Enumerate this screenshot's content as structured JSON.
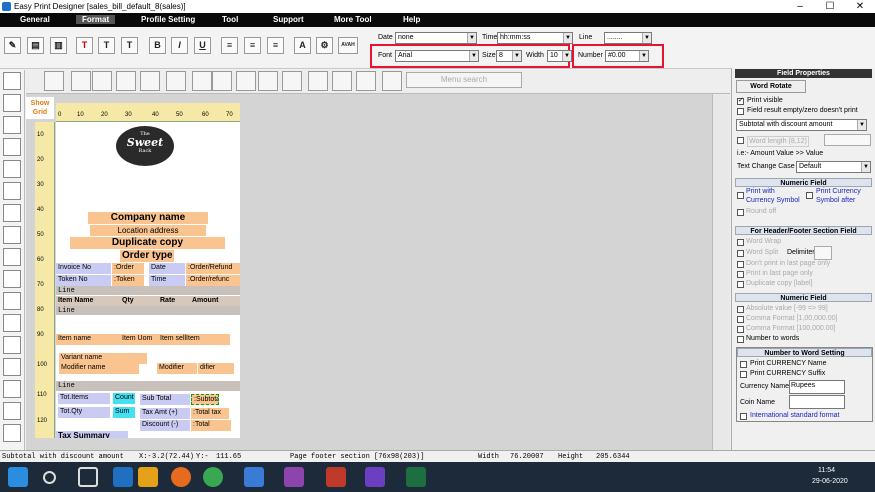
{
  "window": {
    "title": "Easy Print Designer [sales_bill_default_8(sales)]"
  },
  "menu": [
    "General",
    "Format",
    "Profile Setting",
    "Tool",
    "Support",
    "More Tool",
    "Help"
  ],
  "toolbar": {
    "date_label": "Date",
    "date_value": "none",
    "time_label": "Time",
    "time_value": "hh:mm:ss",
    "line_label": "Line",
    "line_value": "........",
    "font_label": "Font",
    "font_value": "Arial",
    "size_label": "Size",
    "size_value": "8",
    "width_label": "Width",
    "width_value": "10",
    "number_label": "Number",
    "number_value": "#0.00",
    "special_btn": "AVAH"
  },
  "page_toolbar": {
    "search_placeholder": "Menu search"
  },
  "left_strip": {
    "show_grid": "Show Grid"
  },
  "ruler": {
    "marks": [
      "0",
      "10",
      "20",
      "30",
      "40",
      "50",
      "60",
      "70"
    ],
    "vmarks": [
      "10",
      "20",
      "30",
      "40",
      "50",
      "60",
      "70",
      "80",
      "90",
      "100",
      "110",
      "120"
    ]
  },
  "logo": {
    "line1": "The",
    "line2": "Sweet",
    "line3": "Rack"
  },
  "report": {
    "company_name": "Company name",
    "location": "Location address",
    "duplicate": "Duplicate copy",
    "order_type": "Order type",
    "invoice_no": "Invoice No",
    "order": ":Order",
    "date": "Date",
    "order_refund": ":Order/Refund",
    "token_no": "Token No",
    "token": ":Token",
    "time": "Time",
    "order_refund2": ":Order/refunc",
    "line": "Line",
    "item_name_h": "Item Name",
    "qty_h": "Qty",
    "rate_h": "Rate",
    "amount_h": "Amount",
    "item_name": "Item name",
    "item_uom": "Item Uom",
    "item_sell": "Item sellItem",
    "variant": "Variant name",
    "modifier_name": "Modifier name",
    "modifier": "Modifier",
    "modifier2": "difier",
    "tot_items": "Tot.Items",
    "count": "Count",
    "sub_total_l": "Sub Total",
    "subtotal": ":Subtotal",
    "tot_qty": "Tot.Qty",
    "sum": "Sum",
    "tax_amt": "Tax Amt  (+)",
    "total_tax": ":Total tax",
    "discount": "Discount  (-)",
    "total": ":Total",
    "tax_summary": "Tax Summary"
  },
  "right_panel": {
    "title": "Field Properties",
    "word_rotate": "Word Rotate",
    "print_visible": "Print visible",
    "field_empty": "Field result empty/zero doesn't print",
    "field_select": "Subtotal with discount amount",
    "word_length": "Word length (8,12)",
    "ie": "i.e:- Amount Value >> Value",
    "text_case": "Text Change Case",
    "text_case_value": "Default",
    "numeric_field": "Numeric Field",
    "print_with_cur": "Print with Currency Symbol",
    "print_cur_after": "Print Currency Symbol after",
    "round_off": "Round off",
    "header_footer": "For Header/Footer Section Field",
    "word_wrap": "Word Wrap",
    "word_split": "Word Split",
    "delimiter": "Delimiter",
    "dont_print_last": "Don't print in  last page only",
    "print_last": "Print in last page only",
    "dup_copy": "Duplicate copy [label]",
    "numeric_field2": "Numeric Field",
    "absolute": "Absolute value  [-99 => 99]",
    "comma1": "Comma Format  [1,00,000.00]",
    "comma2": "Comma Format  [100,000.00]",
    "number_to_words": "Number to words",
    "nw_setting": "Number to Word Setting",
    "print_cur_name": "Print CURRENCY Name",
    "print_cur_suffix": "Print CURRENCY Suffix",
    "currency_name": "Currency Name",
    "currency_value": "Rupees",
    "coin_name": "Coin Name",
    "intl_format": "International standard format"
  },
  "status": {
    "field": "Subtotal with discount amount",
    "x_label": "X:-",
    "x_value": "3.2(72.44)",
    "y_label": "Y:-",
    "y_value": "111.65",
    "section": "Page footer section [76x98(203)]",
    "width_label": "Width",
    "width_value": "76.20007",
    "height_label": "Height",
    "height_value": "205.6344"
  },
  "taskbar": {
    "time": "11:54",
    "date": "29-06-2020"
  }
}
